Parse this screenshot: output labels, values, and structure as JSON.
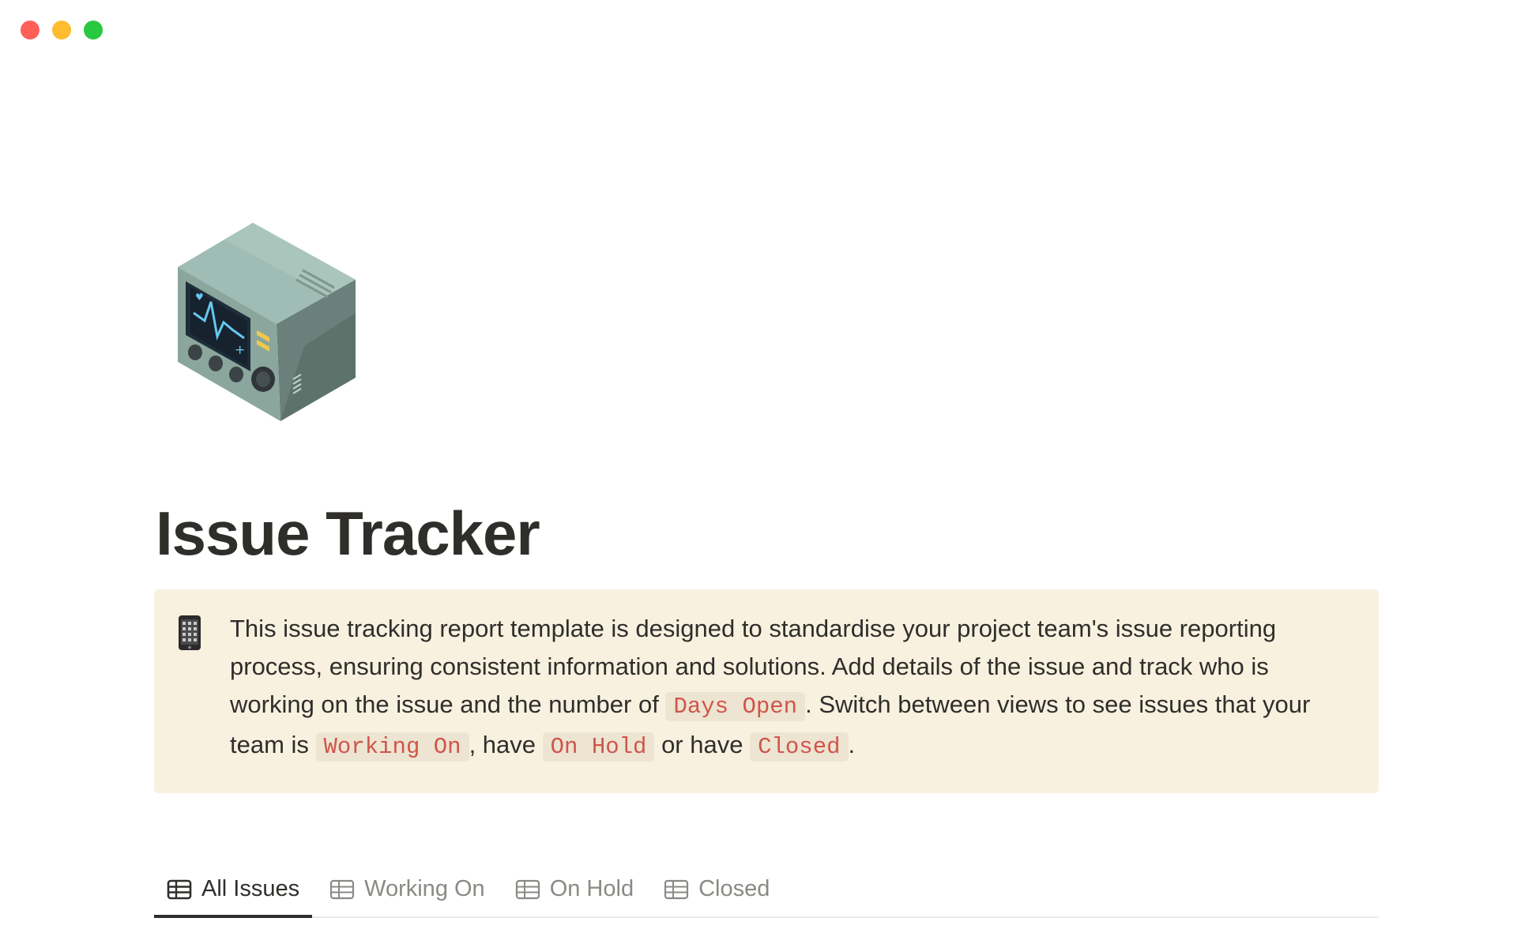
{
  "window": {
    "traffic_lights": {
      "close_color": "#fe5f57",
      "minimize_color": "#febc2e",
      "maximize_color": "#28c840"
    }
  },
  "page": {
    "icon": "medical-monitor-icon",
    "title": "Issue Tracker"
  },
  "callout": {
    "icon": "mobile-phone-icon",
    "background": "#f9f1df",
    "text_1": "This issue tracking report template is designed to standardise your project team's issue reporting process, ensuring consistent information and solutions. Add details of the issue and track who is working on the issue and the number of ",
    "code_days_open": "Days Open",
    "text_2": ". Switch between views to see issues that your team is ",
    "code_working_on": "Working On",
    "text_3": ", have ",
    "code_on_hold": "On Hold",
    "text_4": " or have ",
    "code_closed": "Closed",
    "text_5": "."
  },
  "tabs": [
    {
      "label": "All Issues",
      "icon": "table-icon",
      "active": true
    },
    {
      "label": "Working On",
      "icon": "table-icon",
      "active": false
    },
    {
      "label": "On Hold",
      "icon": "table-icon",
      "active": false
    },
    {
      "label": "Closed",
      "icon": "table-icon",
      "active": false
    }
  ]
}
